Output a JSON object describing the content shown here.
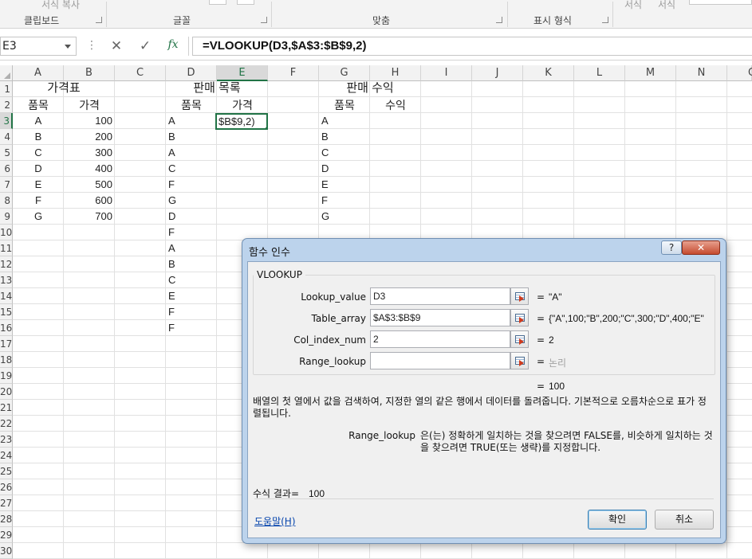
{
  "ribbon": {
    "groups": [
      "클립보드",
      "글꼴",
      "맞춤",
      "표시 형식"
    ],
    "faded_items": [
      "서식 복사",
      "서식",
      "서식"
    ]
  },
  "formula_bar": {
    "name_box": "E3",
    "cancel_symbol": "✕",
    "enter_symbol": "✓",
    "fx_symbol": "fx",
    "formula": "=VLOOKUP(D3,$A$3:$B$9,2)"
  },
  "grid": {
    "columns": [
      "A",
      "B",
      "C",
      "D",
      "E",
      "F",
      "G",
      "H",
      "I",
      "J",
      "K",
      "L",
      "M",
      "N",
      "O"
    ],
    "rows": [
      "1",
      "2",
      "3",
      "4",
      "5",
      "6",
      "7",
      "8",
      "9",
      "10",
      "11",
      "12",
      "13",
      "14",
      "15",
      "16",
      "17",
      "18",
      "19",
      "20",
      "21",
      "22",
      "23",
      "24",
      "25",
      "26",
      "27",
      "28",
      "29",
      "30"
    ],
    "selected_column": "E",
    "selected_row": "3",
    "price_table": {
      "title": "가격표",
      "headers": [
        "품목",
        "가격"
      ],
      "items": [
        "A",
        "B",
        "C",
        "D",
        "E",
        "F",
        "G"
      ],
      "prices": [
        "100",
        "200",
        "300",
        "400",
        "500",
        "600",
        "700"
      ]
    },
    "sales_list": {
      "title": "판매 목록",
      "headers": [
        "품목",
        "가격"
      ],
      "items": [
        "A",
        "B",
        "A",
        "C",
        "F",
        "G",
        "D",
        "F",
        "A",
        "B",
        "C",
        "E",
        "F",
        "F"
      ]
    },
    "revenue": {
      "title": "판매 수익",
      "headers": [
        "품목",
        "수익"
      ],
      "items": [
        "A",
        "B",
        "C",
        "D",
        "E",
        "F",
        "G"
      ]
    },
    "active_cell_text": "$B$9,2)"
  },
  "dialog": {
    "title": "함수 인수",
    "help_button": "?",
    "close_button": "✕",
    "function_name": "VLOOKUP",
    "args": [
      {
        "label": "Lookup_value",
        "value": "D3",
        "result": "\"A\""
      },
      {
        "label": "Table_array",
        "value": "$A$3:$B$9",
        "result": "{\"A\",100;\"B\",200;\"C\",300;\"D\",400;\"E\""
      },
      {
        "label": "Col_index_num",
        "value": "2",
        "result": "2"
      },
      {
        "label": "Range_lookup",
        "value": "",
        "result": "논리"
      }
    ],
    "equals": "=",
    "total_result": "100",
    "description": "배열의 첫 열에서 값을 검색하여, 지정한 열의 같은 행에서 데이터를 돌려줍니다. 기본적으로 오름차순으로 표가 정렬됩니다.",
    "arg_help_name": "Range_lookup",
    "arg_help_text": "은(는) 정확하게 일치하는 것을 찾으려면 FALSE를, 비슷하게 일치하는 것을 찾으려면 TRUE(또는 생략)를 지정합니다.",
    "formula_result_label": "수식 결과=",
    "formula_result_value": "100",
    "help_link": "도움말(H)",
    "ok_label": "확인",
    "cancel_label": "취소"
  }
}
